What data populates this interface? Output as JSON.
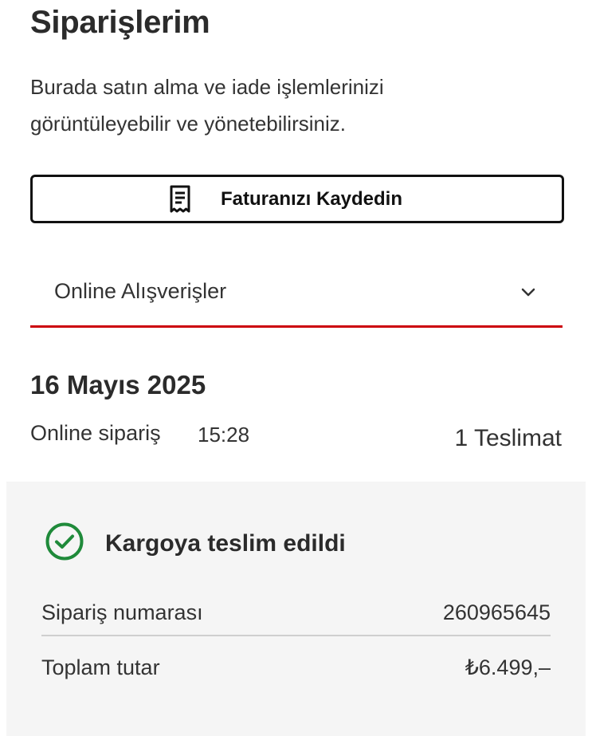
{
  "header": {
    "title": "Siparişlerim",
    "intro": "Burada satın alma ve iade işlemlerinizi görüntüleyebilir ve yönetebilirsiniz."
  },
  "invoice_button": {
    "label": "Faturanızı Kaydedin",
    "icon": "receipt-icon"
  },
  "filter": {
    "selected": "Online Alışverişler",
    "icon": "chevron-down-icon",
    "accent_color": "#cc0008"
  },
  "order": {
    "date": "16 Mayıs 2025",
    "type": "Online sipariş",
    "time": "15:28",
    "deliveries": "1 Teslimat",
    "status": {
      "label": "Kargoya teslim edildi",
      "icon": "check-circle-icon",
      "color": "#1f8a3a"
    },
    "details": [
      {
        "label": "Sipariş numarası",
        "value": "260965645"
      },
      {
        "label": "Toplam tutar",
        "value": "₺6.499,–"
      }
    ]
  }
}
